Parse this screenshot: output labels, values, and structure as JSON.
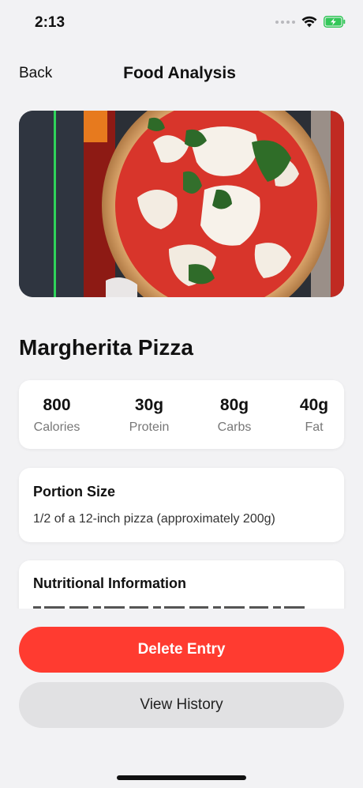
{
  "status_bar": {
    "time": "2:13",
    "icons": [
      "signal-dots-icon",
      "wifi-icon",
      "battery-charging-icon"
    ]
  },
  "nav": {
    "back_label": "Back",
    "title": "Food Analysis"
  },
  "food": {
    "image_subject": "pizza-photo",
    "name": "Margherita Pizza"
  },
  "macros": [
    {
      "value": "800",
      "label": "Calories"
    },
    {
      "value": "30g",
      "label": "Protein"
    },
    {
      "value": "80g",
      "label": "Carbs"
    },
    {
      "value": "40g",
      "label": "Fat"
    }
  ],
  "portion": {
    "title": "Portion Size",
    "text": "1/2 of a 12-inch pizza (approximately 200g)"
  },
  "nutrition": {
    "title": "Nutritional Information"
  },
  "actions": {
    "delete_label": "Delete Entry",
    "history_label": "View History"
  },
  "colors": {
    "accent_red": "#ff3b30",
    "secondary_button": "#e1e1e3",
    "background": "#f2f2f4",
    "battery_green": "#34c759"
  }
}
